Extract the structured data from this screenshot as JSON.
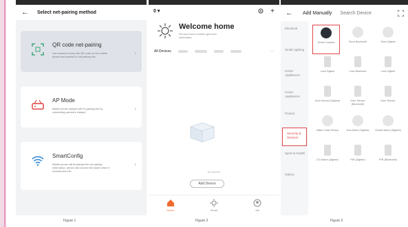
{
  "screen1": {
    "title": "Select net-pairing method",
    "options": [
      {
        "title": "QR code net-pairing",
        "desc": "Use camera to scan the QR code on the mobile phone and connect to net-pairing info",
        "icon": "qr-scan-icon",
        "active": true
      },
      {
        "title": "AP Mode",
        "desc": "Mobile phone hotspot (Wi-Fi) pairing info by connecting camera's hotspot",
        "icon": "router-icon",
        "active": false
      },
      {
        "title": "SmartConfig",
        "desc": "Mobile phone will broadcast the net-pairing information, device will connect the router when it receives the info",
        "icon": "wifi-icon",
        "active": false
      }
    ],
    "caption": "Figure 1"
  },
  "screen2": {
    "home_selector": "0",
    "welcome_title": "Welcome home",
    "welcome_sub": "Set your home location get more information",
    "all_devices": "All Devices",
    "more": "···",
    "no_devices": "No devices",
    "add_device": "Add Device",
    "nav": [
      "Home",
      "Smart",
      "Me"
    ],
    "caption": "Figure 2"
  },
  "screen3": {
    "tab_add": "Add Manually",
    "tab_search": "Search Device",
    "categories": [
      "Electrical",
      "Small Lighting",
      "Home Appliances",
      "Home Appliances",
      "Protect",
      "Security & Sensors",
      "Sport & Health",
      "Others"
    ],
    "tiles": [
      {
        "label": "Smart Camera",
        "style": "dark",
        "selected": true
      },
      {
        "label": "Siren Bluetooth",
        "style": "round",
        "selected": false
      },
      {
        "label": "Siren Zigbee",
        "style": "round",
        "selected": false
      },
      {
        "label": "Lock Zigbee",
        "style": "rect",
        "selected": false
      },
      {
        "label": "Lock Bluetooth",
        "style": "rect",
        "selected": false
      },
      {
        "label": "Lock Zigbee",
        "style": "rect",
        "selected": false
      },
      {
        "label": "Door Sensor (Zigbee)",
        "style": "rect",
        "selected": false
      },
      {
        "label": "Door Sensor (Bluetooth)",
        "style": "rect",
        "selected": false
      },
      {
        "label": "Door Sensor",
        "style": "rect",
        "selected": false
      },
      {
        "label": "Water Leak Sensor",
        "style": "round",
        "selected": false
      },
      {
        "label": "Gas Alarm (Zigbee)",
        "style": "round",
        "selected": false
      },
      {
        "label": "Smoke Alarm (Zigbee)",
        "style": "round",
        "selected": false
      },
      {
        "label": "CO Alarm (Zigbee)",
        "style": "rect",
        "selected": false
      },
      {
        "label": "PIR (Zigbee)",
        "style": "rect",
        "selected": false
      },
      {
        "label": "PIR (Bluetooth)",
        "style": "rect",
        "selected": false
      }
    ],
    "caption": "Figure 3"
  },
  "colors": {
    "accent": "#ef6a2c",
    "highlight": "#e14545",
    "card_active": "#dfe2e8"
  }
}
